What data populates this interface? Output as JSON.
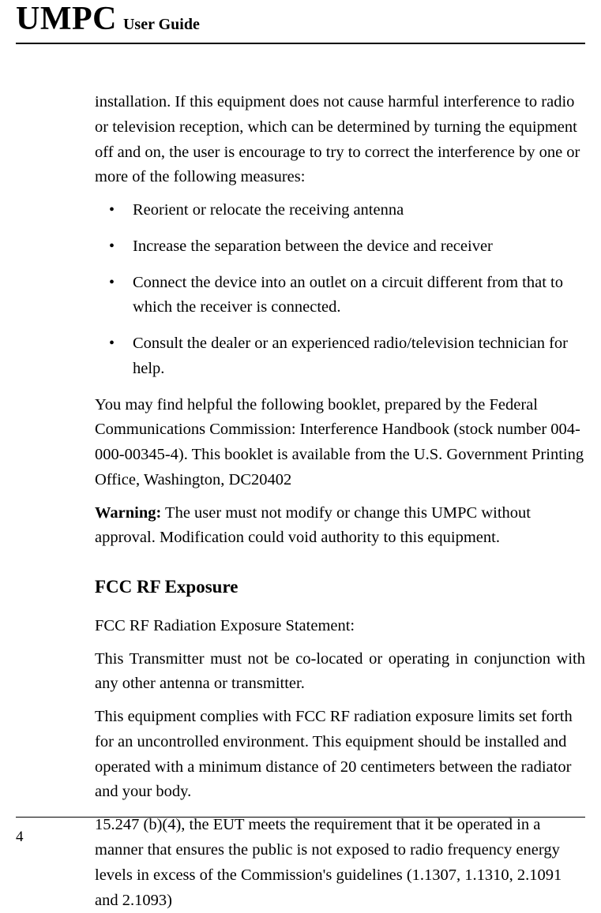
{
  "header": {
    "prefix": "UMPC",
    "suffix": "User Guide"
  },
  "content": {
    "intro_para": "installation. If this equipment does not cause harmful interference to radio or television reception, which can be determined by turning the equipment off and on, the user is encourage to try to correct the interference by one or more of the following measures:",
    "bullets": [
      "Reorient or relocate the receiving antenna",
      "Increase the separation between the device and receiver",
      "Connect the device into an outlet on a circuit different from that to which the receiver is connected.",
      "Consult the dealer or an experienced radio/television technician for help."
    ],
    "booklet_para": "You may find helpful the following booklet, prepared by the Federal Communications Commission: Interference Handbook (stock number 004-000-00345-4). This booklet is available from the U.S. Government Printing Office, Washington, DC20402",
    "warning_label": "Warning:",
    "warning_text": " The user must not modify or change this UMPC without approval. Modification could void authority to this equipment.",
    "fcc_heading": "FCC RF Exposure",
    "fcc_statement": "FCC RF Radiation Exposure Statement:",
    "transmitter_para": "This Transmitter must not be co-located or operating in conjunction with any other antenna or transmitter.",
    "compliance_para": "This equipment complies with FCC RF radiation exposure limits set forth for an uncontrolled environment. This equipment should be installed and operated with a minimum distance of 20 centimeters between the radiator and your body.",
    "eut_para": "15.247 (b)(4), the EUT meets the requirement that it be operated in a manner that ensures the public is not exposed to radio frequency energy levels in excess of the Commission's guidelines (1.1307, 1.1310, 2.1091 and 2.1093)"
  },
  "footer": {
    "page_number": "4"
  }
}
